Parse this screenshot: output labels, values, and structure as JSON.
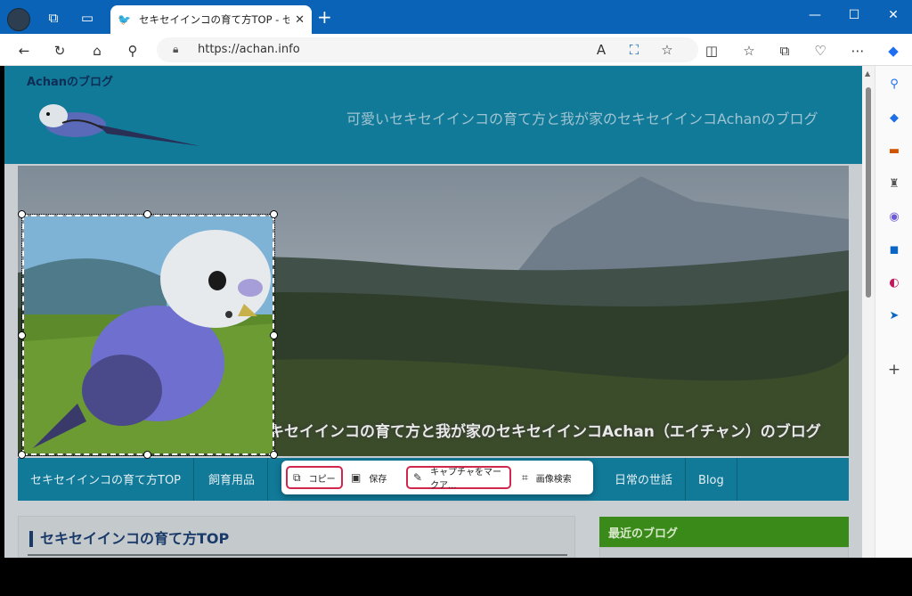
{
  "browser": {
    "tab_title": "セキセイインコの育て方TOP - セキセ",
    "url": "https://achan.info",
    "new_tab_label": "+",
    "window_minimize": "—",
    "window_maximize": "☐",
    "window_close": "✕"
  },
  "site": {
    "blog_name": "Achanのブログ",
    "tagline": "可愛いセキセイインコの育て方と我が家のセキセイインコAchanのブログ",
    "hero_caption": "セキセイインコの育て方と我が家のセキセイインコAchan（エイチャン）のブログ",
    "nav": [
      {
        "label": "セキセイインコの育て方TOP"
      },
      {
        "label": "飼育用品"
      },
      {
        "label": "日常の世話"
      },
      {
        "label": "Blog"
      }
    ],
    "content_heading": "セキセイインコの育て方TOP",
    "sidebar_heading": "最近のブログ"
  },
  "capture_menu": {
    "copy": "コピー",
    "save": "保存",
    "markup": "キャプチャをマークア...",
    "image_search": "画像検索"
  },
  "colors": {
    "titlebar": "#0a63b6",
    "header": "#117a99",
    "highlight": "#d1274d"
  }
}
